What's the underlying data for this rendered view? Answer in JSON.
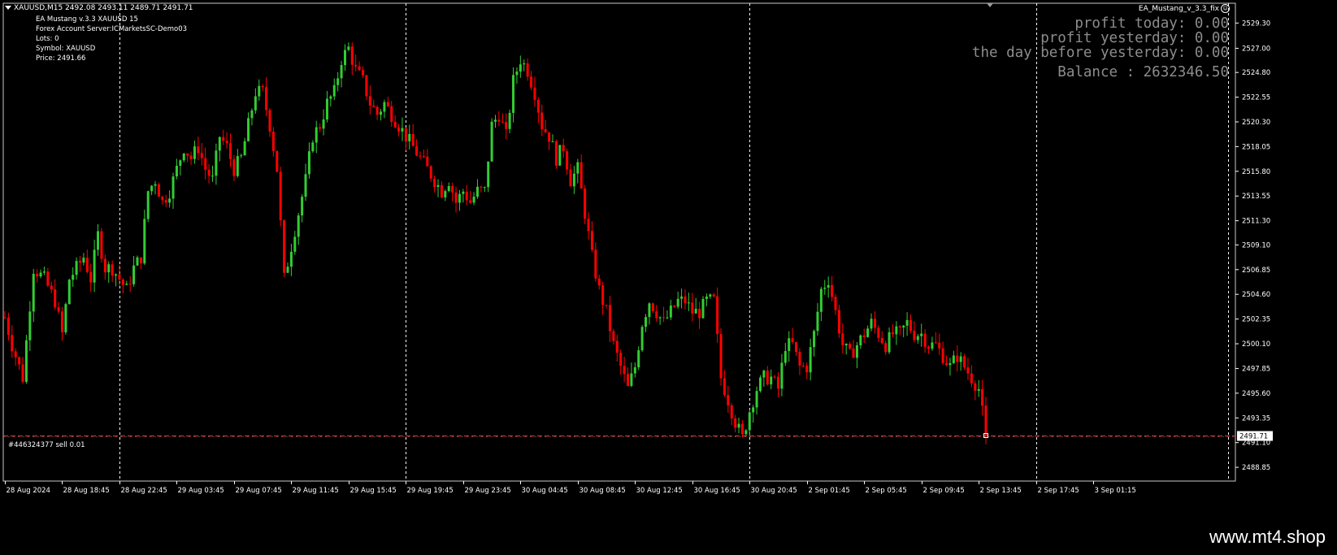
{
  "header": {
    "symbol_line": "XAUUSD,M15  2492.08 2493.11 2489.71 2491.71"
  },
  "info": {
    "lines": [
      "EA Mustang v.3.3 XAUUSD  15",
      "Forex Account Server:ICMarketsSC-Demo03",
      "Lots:  0",
      "Symbol: XAUUSD",
      "Price:  2491.66"
    ]
  },
  "ea_tag": {
    "label": "EA_Mustang_v_3.3_fix",
    "icon": "smiley-icon"
  },
  "stats": {
    "profit_today": "profit today: 0.00",
    "profit_yesterday": "profit yesterday: 0.00",
    "day_before": "the day before yesterday: 0.00",
    "balance": "Balance : 2632346.50"
  },
  "order_line": {
    "label": "#446324377 sell 0.01",
    "price_tag": "2491.71"
  },
  "watermark": "www.mt4.shop",
  "colors": {
    "bull": "#32cd32",
    "bear": "#ff0000",
    "grid": "#ffffff",
    "order_line": "#ff3333",
    "axis_text": "#ffffff"
  },
  "chart_data": {
    "type": "candlestick",
    "symbol": "XAUUSD",
    "timeframe": "M15",
    "ylim": [
      2487.6,
      2531.1
    ],
    "y_ticks": [
      "2529.30",
      "2527.00",
      "2524.80",
      "2522.55",
      "2520.30",
      "2518.05",
      "2515.80",
      "2513.55",
      "2511.30",
      "2509.10",
      "2506.85",
      "2504.60",
      "2502.35",
      "2500.10",
      "2497.85",
      "2495.60",
      "2493.35",
      "2491.10",
      "2488.85"
    ],
    "x_ticks": [
      "28 Aug 2024",
      "28 Aug 18:45",
      "28 Aug 22:45",
      "29 Aug 03:45",
      "29 Aug 07:45",
      "29 Aug 11:45",
      "29 Aug 15:45",
      "29 Aug 19:45",
      "29 Aug 23:45",
      "30 Aug 04:45",
      "30 Aug 08:45",
      "30 Aug 12:45",
      "30 Aug 16:45",
      "30 Aug 20:45",
      "2 Sep 01:45",
      "2 Sep 05:45",
      "2 Sep 09:45",
      "2 Sep 13:45",
      "2 Sep 17:45",
      "3 Sep 01:15"
    ],
    "day_separators": [
      "28 Aug 22:45",
      "29 Aug 19:45",
      "30 Aug 20:45",
      "2 Sep 17:45"
    ],
    "order_price": 2491.71,
    "last_close": 2491.71,
    "path": [
      [
        0,
        2502.5
      ],
      [
        2,
        2500
      ],
      [
        5,
        2497
      ],
      [
        8,
        2507
      ],
      [
        11,
        2506
      ],
      [
        14,
        2504
      ],
      [
        16,
        2501
      ],
      [
        18,
        2506
      ],
      [
        20,
        2507
      ],
      [
        22,
        2508
      ],
      [
        24,
        2506
      ],
      [
        26,
        2510
      ],
      [
        28,
        2507
      ],
      [
        30,
        2507
      ],
      [
        32,
        2506
      ],
      [
        34,
        2505
      ],
      [
        36,
        2507
      ],
      [
        38,
        2508
      ],
      [
        40,
        2514
      ],
      [
        42,
        2515
      ],
      [
        44,
        2513
      ],
      [
        46,
        2514
      ],
      [
        48,
        2516
      ],
      [
        50,
        2518
      ],
      [
        52,
        2517
      ],
      [
        54,
        2518
      ],
      [
        56,
        2516
      ],
      [
        58,
        2515
      ],
      [
        60,
        2519
      ],
      [
        62,
        2518
      ],
      [
        64,
        2516
      ],
      [
        66,
        2517
      ],
      [
        68,
        2520
      ],
      [
        70,
        2523
      ],
      [
        72,
        2523
      ],
      [
        74,
        2520
      ],
      [
        76,
        2516
      ],
      [
        78,
        2506
      ],
      [
        80,
        2509
      ],
      [
        82,
        2512
      ],
      [
        84,
        2515
      ],
      [
        86,
        2519
      ],
      [
        88,
        2520
      ],
      [
        90,
        2522
      ],
      [
        92,
        2523
      ],
      [
        94,
        2526
      ],
      [
        96,
        2527
      ],
      [
        98,
        2525
      ],
      [
        100,
        2524
      ],
      [
        102,
        2522
      ],
      [
        104,
        2521
      ],
      [
        106,
        2522
      ],
      [
        108,
        2521
      ],
      [
        110,
        2520
      ],
      [
        112,
        2519
      ],
      [
        114,
        2518
      ],
      [
        116,
        2517
      ],
      [
        118,
        2516
      ],
      [
        120,
        2515
      ],
      [
        122,
        2514
      ],
      [
        124,
        2515
      ],
      [
        126,
        2513
      ],
      [
        128,
        2514
      ],
      [
        130,
        2513
      ],
      [
        132,
        2514
      ],
      [
        134,
        2514
      ],
      [
        136,
        2520
      ],
      [
        138,
        2521
      ],
      [
        140,
        2519
      ],
      [
        142,
        2524
      ],
      [
        144,
        2526
      ],
      [
        146,
        2525
      ],
      [
        148,
        2523
      ],
      [
        150,
        2520
      ],
      [
        152,
        2519
      ],
      [
        154,
        2517
      ],
      [
        156,
        2518
      ],
      [
        158,
        2515
      ],
      [
        160,
        2516
      ],
      [
        162,
        2512
      ],
      [
        164,
        2508
      ],
      [
        166,
        2505
      ],
      [
        168,
        2503
      ],
      [
        170,
        2500
      ],
      [
        172,
        2498
      ],
      [
        174,
        2496
      ],
      [
        176,
        2498
      ],
      [
        178,
        2502
      ],
      [
        180,
        2504
      ],
      [
        182,
        2503
      ],
      [
        184,
        2502
      ],
      [
        186,
        2503
      ],
      [
        188,
        2504
      ],
      [
        190,
        2504
      ],
      [
        192,
        2503
      ],
      [
        194,
        2503
      ],
      [
        196,
        2504
      ],
      [
        198,
        2504
      ],
      [
        200,
        2497
      ],
      [
        202,
        2495
      ],
      [
        204,
        2493
      ],
      [
        206,
        2491.5
      ],
      [
        208,
        2494
      ],
      [
        210,
        2496
      ],
      [
        212,
        2497
      ],
      [
        214,
        2497
      ],
      [
        216,
        2496
      ],
      [
        218,
        2500
      ],
      [
        220,
        2500
      ],
      [
        222,
        2498
      ],
      [
        224,
        2498
      ],
      [
        226,
        2501
      ],
      [
        228,
        2505
      ],
      [
        230,
        2506
      ],
      [
        232,
        2503
      ],
      [
        234,
        2500
      ],
      [
        236,
        2499
      ],
      [
        238,
        2500
      ],
      [
        240,
        2501
      ],
      [
        242,
        2502
      ],
      [
        244,
        2501
      ],
      [
        246,
        2500
      ],
      [
        248,
        2501
      ],
      [
        250,
        2501
      ],
      [
        252,
        2502
      ],
      [
        254,
        2501
      ],
      [
        256,
        2501
      ],
      [
        258,
        2500
      ],
      [
        260,
        2500
      ],
      [
        262,
        2499
      ],
      [
        264,
        2498
      ],
      [
        266,
        2499
      ],
      [
        268,
        2498
      ],
      [
        270,
        2497
      ],
      [
        272,
        2496
      ],
      [
        274,
        2491.71
      ]
    ]
  }
}
